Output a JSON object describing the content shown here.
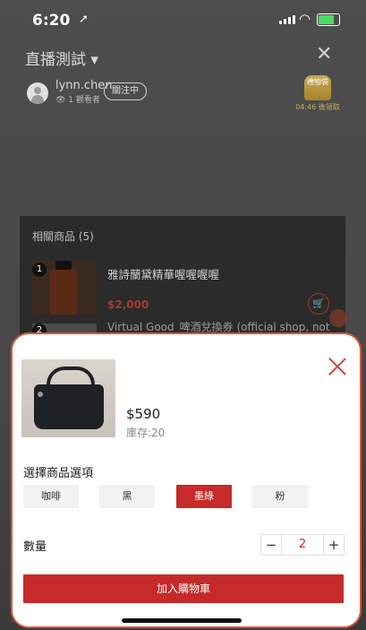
{
  "status": {
    "time": "6:20",
    "location_icon": "location-arrow-icon"
  },
  "live": {
    "title": "直播測試 ▾",
    "user": {
      "name": "lynn.chen",
      "viewers": "👁 1 觀看者",
      "follow_label": "關注中"
    },
    "badge": {
      "label": "禮物袋",
      "countdown": "04:46 後領取"
    }
  },
  "related": {
    "title": "相關商品 (5)",
    "items": [
      {
        "index": "1",
        "name": "雅詩蘭黛精華喔喔喔喔",
        "price": "$2,000"
      },
      {
        "index": "2",
        "name": "Virtual Good_啤酒兌換券 (official shop, not SBS, not W..."
      }
    ]
  },
  "sheet": {
    "price": "$590",
    "stock": "庫存:20",
    "options_title": "選擇商品選項",
    "options": [
      "咖啡",
      "黑",
      "墨綠",
      "粉"
    ],
    "selected_option": "墨綠",
    "quantity_label": "數量",
    "quantity_value": "2",
    "minus": "−",
    "plus": "+",
    "add_to_cart": "加入購物車"
  },
  "colors": {
    "accent": "#c62a2a",
    "sheet_border": "#d85638"
  }
}
